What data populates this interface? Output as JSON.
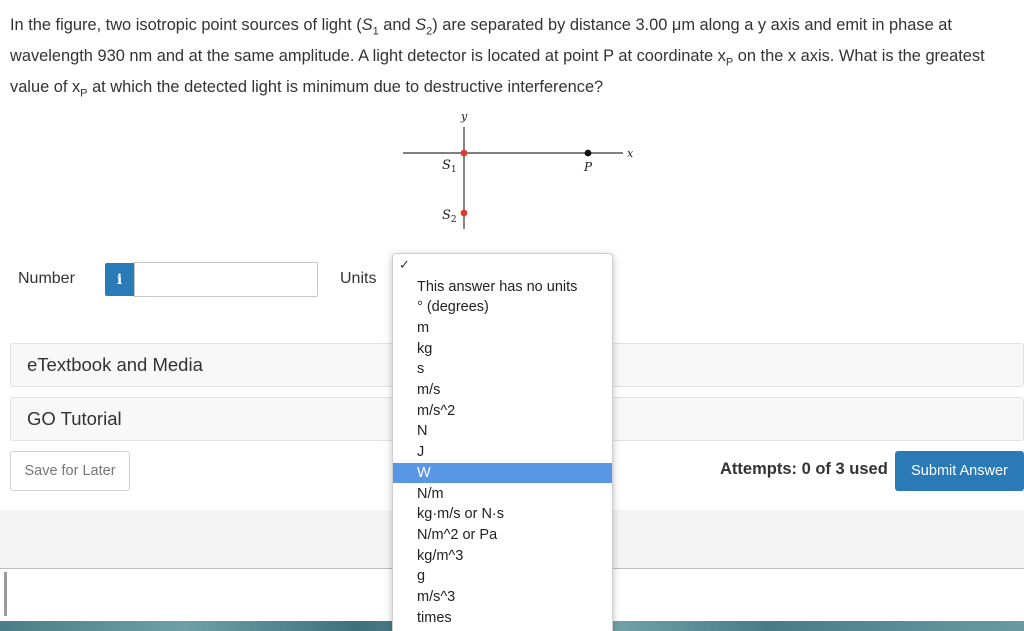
{
  "question": {
    "part1": "In the figure, two isotropic point sources of light (",
    "s1": "S",
    "s1_sub": "1",
    "and": " and ",
    "s2": "S",
    "s2_sub": "2",
    "part2": ") are separated by distance 3.00 μm along a y axis and emit in phase at wavelength 930 nm and at the same amplitude. A light detector is located at point P at coordinate x",
    "xp_sub": "P",
    "part3": " on the x axis. What is the greatest value of x",
    "xp_sub2": "P",
    "part4": " at which the detected light is minimum due to destructive interference?"
  },
  "figure": {
    "y_label": "y",
    "x_label": "x",
    "s1_label": "S",
    "s1_sub": "1",
    "s2_label": "S",
    "s2_sub": "2",
    "p_label": "P",
    "source_color": "#e03a2f",
    "detector_color": "#111111"
  },
  "answer": {
    "number_label": "Number",
    "info_icon_text": "i",
    "number_value": "",
    "units_label": "Units"
  },
  "units_dropdown": {
    "check_mark": "✓",
    "selected_index": 9,
    "options": [
      "This answer has no units",
      "° (degrees)",
      "m",
      "kg",
      "s",
      "m/s",
      "m/s^2",
      "N",
      "J",
      "W",
      "N/m",
      "kg·m/s or N·s",
      "N/m^2 or Pa",
      "kg/m^3",
      "g",
      "m/s^3",
      "times"
    ]
  },
  "sections": {
    "etextbook": "eTextbook and Media",
    "go_tutorial": "GO Tutorial"
  },
  "actions": {
    "save_later": "Save for Later",
    "attempts": "Attempts: 0 of 3 used",
    "submit": "Submit Answer"
  },
  "colors": {
    "accent_blue": "#2a7ab8",
    "selected_option": "#5a96e6"
  }
}
